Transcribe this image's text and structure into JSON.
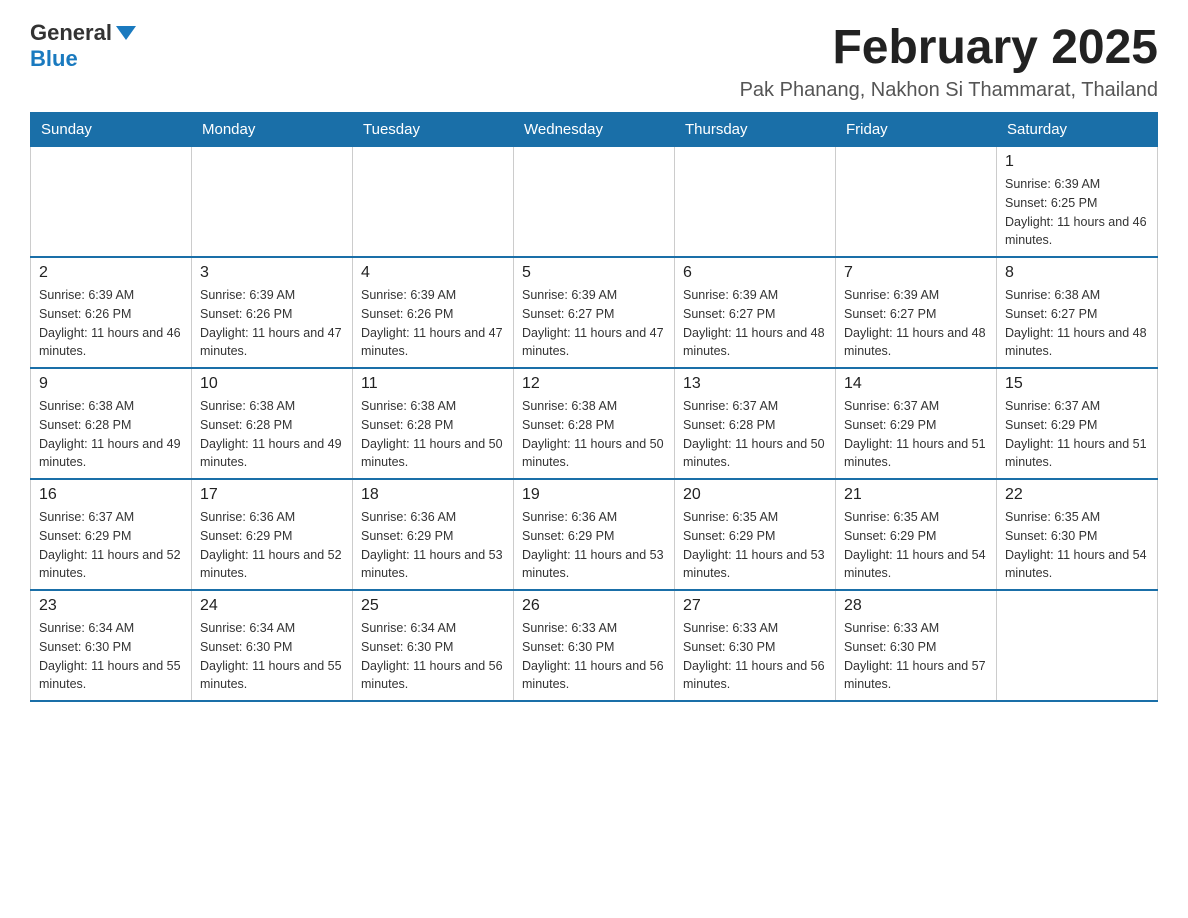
{
  "logo": {
    "general": "General",
    "blue": "Blue"
  },
  "title": "February 2025",
  "subtitle": "Pak Phanang, Nakhon Si Thammarat, Thailand",
  "headers": [
    "Sunday",
    "Monday",
    "Tuesday",
    "Wednesday",
    "Thursday",
    "Friday",
    "Saturday"
  ],
  "weeks": [
    [
      {
        "day": "",
        "info": ""
      },
      {
        "day": "",
        "info": ""
      },
      {
        "day": "",
        "info": ""
      },
      {
        "day": "",
        "info": ""
      },
      {
        "day": "",
        "info": ""
      },
      {
        "day": "",
        "info": ""
      },
      {
        "day": "1",
        "info": "Sunrise: 6:39 AM\nSunset: 6:25 PM\nDaylight: 11 hours and 46 minutes."
      }
    ],
    [
      {
        "day": "2",
        "info": "Sunrise: 6:39 AM\nSunset: 6:26 PM\nDaylight: 11 hours and 46 minutes."
      },
      {
        "day": "3",
        "info": "Sunrise: 6:39 AM\nSunset: 6:26 PM\nDaylight: 11 hours and 47 minutes."
      },
      {
        "day": "4",
        "info": "Sunrise: 6:39 AM\nSunset: 6:26 PM\nDaylight: 11 hours and 47 minutes."
      },
      {
        "day": "5",
        "info": "Sunrise: 6:39 AM\nSunset: 6:27 PM\nDaylight: 11 hours and 47 minutes."
      },
      {
        "day": "6",
        "info": "Sunrise: 6:39 AM\nSunset: 6:27 PM\nDaylight: 11 hours and 48 minutes."
      },
      {
        "day": "7",
        "info": "Sunrise: 6:39 AM\nSunset: 6:27 PM\nDaylight: 11 hours and 48 minutes."
      },
      {
        "day": "8",
        "info": "Sunrise: 6:38 AM\nSunset: 6:27 PM\nDaylight: 11 hours and 48 minutes."
      }
    ],
    [
      {
        "day": "9",
        "info": "Sunrise: 6:38 AM\nSunset: 6:28 PM\nDaylight: 11 hours and 49 minutes."
      },
      {
        "day": "10",
        "info": "Sunrise: 6:38 AM\nSunset: 6:28 PM\nDaylight: 11 hours and 49 minutes."
      },
      {
        "day": "11",
        "info": "Sunrise: 6:38 AM\nSunset: 6:28 PM\nDaylight: 11 hours and 50 minutes."
      },
      {
        "day": "12",
        "info": "Sunrise: 6:38 AM\nSunset: 6:28 PM\nDaylight: 11 hours and 50 minutes."
      },
      {
        "day": "13",
        "info": "Sunrise: 6:37 AM\nSunset: 6:28 PM\nDaylight: 11 hours and 50 minutes."
      },
      {
        "day": "14",
        "info": "Sunrise: 6:37 AM\nSunset: 6:29 PM\nDaylight: 11 hours and 51 minutes."
      },
      {
        "day": "15",
        "info": "Sunrise: 6:37 AM\nSunset: 6:29 PM\nDaylight: 11 hours and 51 minutes."
      }
    ],
    [
      {
        "day": "16",
        "info": "Sunrise: 6:37 AM\nSunset: 6:29 PM\nDaylight: 11 hours and 52 minutes."
      },
      {
        "day": "17",
        "info": "Sunrise: 6:36 AM\nSunset: 6:29 PM\nDaylight: 11 hours and 52 minutes."
      },
      {
        "day": "18",
        "info": "Sunrise: 6:36 AM\nSunset: 6:29 PM\nDaylight: 11 hours and 53 minutes."
      },
      {
        "day": "19",
        "info": "Sunrise: 6:36 AM\nSunset: 6:29 PM\nDaylight: 11 hours and 53 minutes."
      },
      {
        "day": "20",
        "info": "Sunrise: 6:35 AM\nSunset: 6:29 PM\nDaylight: 11 hours and 53 minutes."
      },
      {
        "day": "21",
        "info": "Sunrise: 6:35 AM\nSunset: 6:29 PM\nDaylight: 11 hours and 54 minutes."
      },
      {
        "day": "22",
        "info": "Sunrise: 6:35 AM\nSunset: 6:30 PM\nDaylight: 11 hours and 54 minutes."
      }
    ],
    [
      {
        "day": "23",
        "info": "Sunrise: 6:34 AM\nSunset: 6:30 PM\nDaylight: 11 hours and 55 minutes."
      },
      {
        "day": "24",
        "info": "Sunrise: 6:34 AM\nSunset: 6:30 PM\nDaylight: 11 hours and 55 minutes."
      },
      {
        "day": "25",
        "info": "Sunrise: 6:34 AM\nSunset: 6:30 PM\nDaylight: 11 hours and 56 minutes."
      },
      {
        "day": "26",
        "info": "Sunrise: 6:33 AM\nSunset: 6:30 PM\nDaylight: 11 hours and 56 minutes."
      },
      {
        "day": "27",
        "info": "Sunrise: 6:33 AM\nSunset: 6:30 PM\nDaylight: 11 hours and 56 minutes."
      },
      {
        "day": "28",
        "info": "Sunrise: 6:33 AM\nSunset: 6:30 PM\nDaylight: 11 hours and 57 minutes."
      },
      {
        "day": "",
        "info": ""
      }
    ]
  ]
}
